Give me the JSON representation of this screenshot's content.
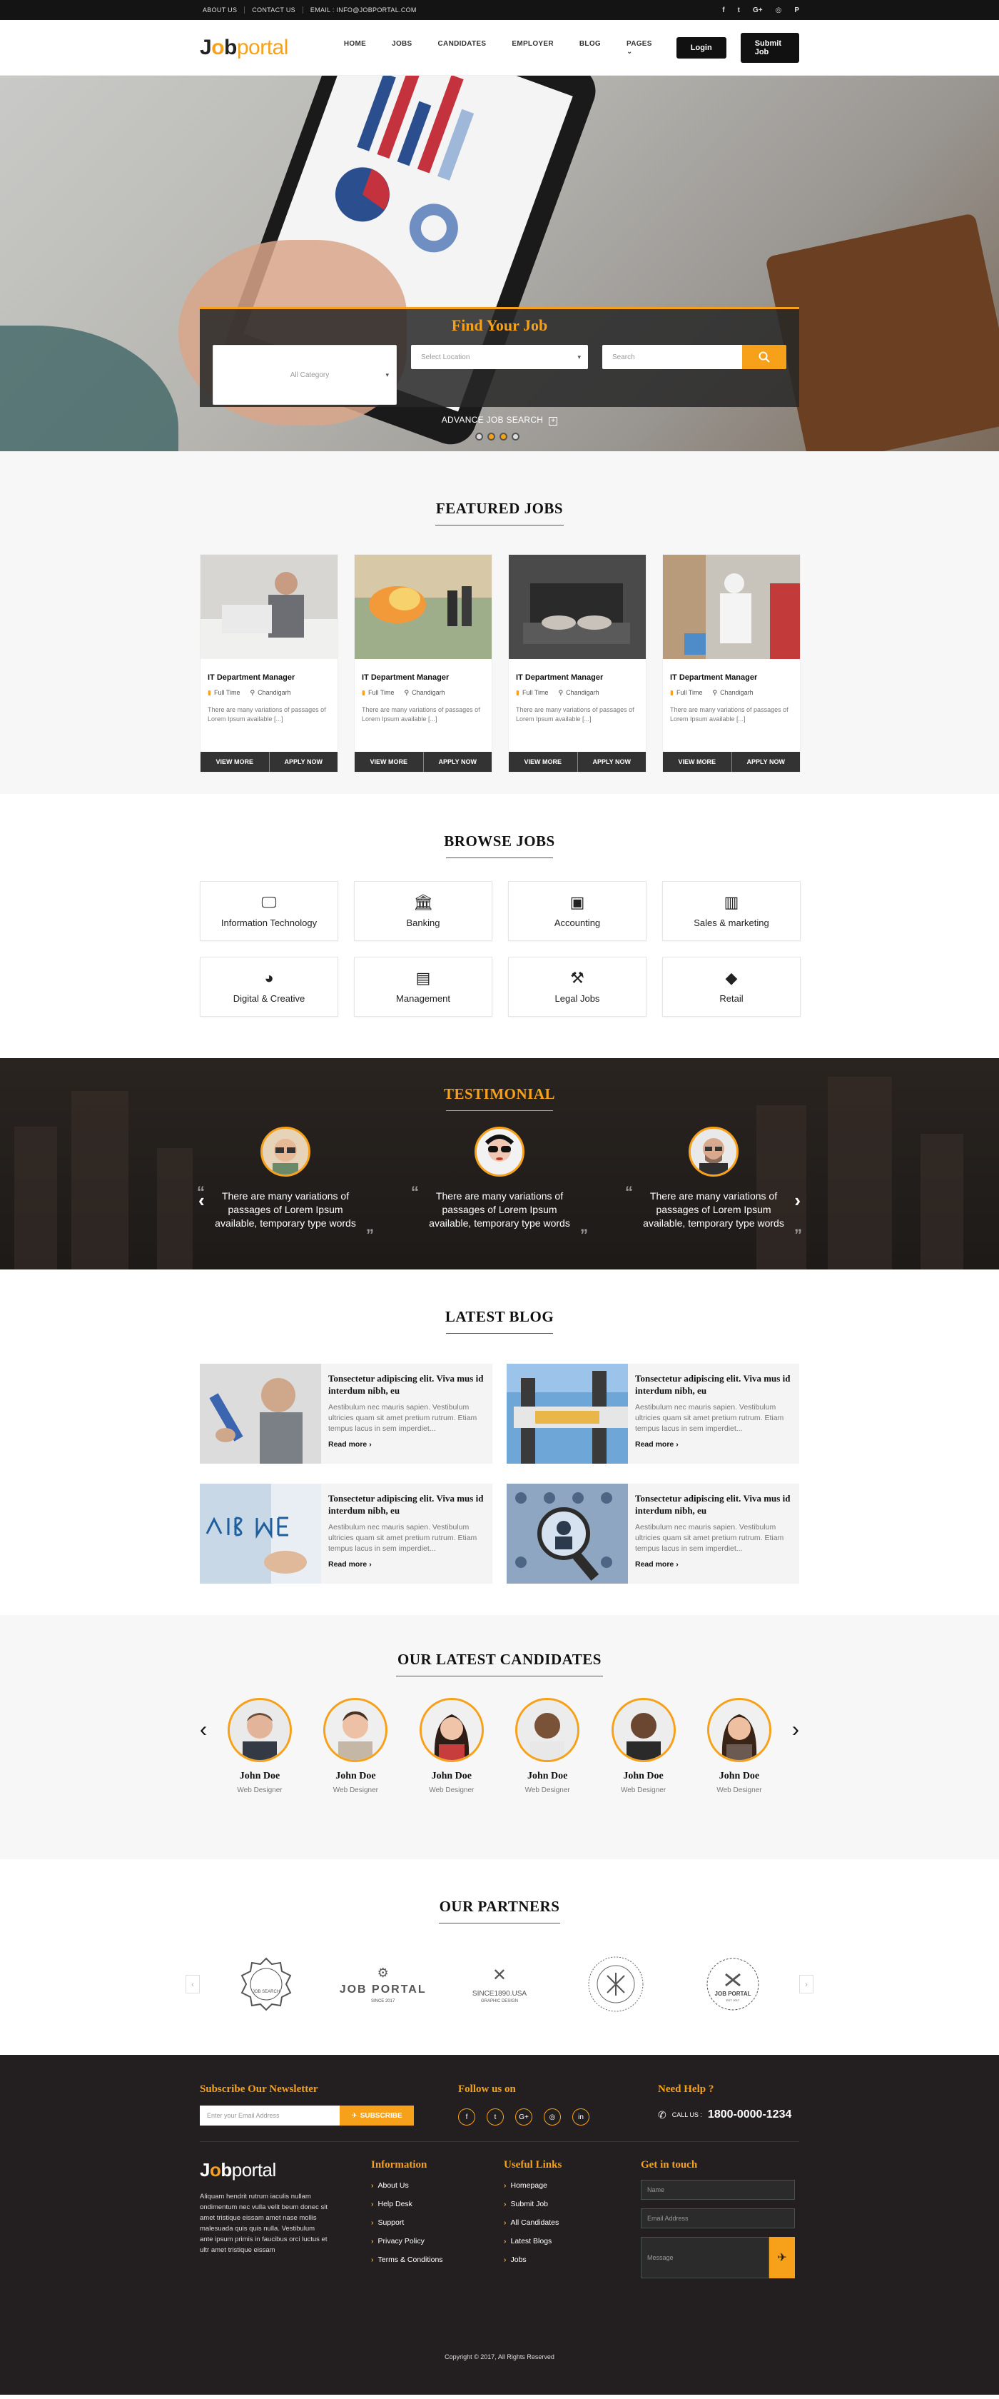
{
  "topbar": {
    "links": [
      "ABOUT US",
      "CONTACT US",
      "EMAIL : INFO@JOBPORTAL.COM"
    ],
    "socials": [
      "f",
      "t",
      "G+",
      "◎",
      "P"
    ]
  },
  "header": {
    "logo_j": "J",
    "logo_o": "o",
    "logo_b": "b",
    "logo_portal": "portal",
    "nav": [
      "HOME",
      "JOBS",
      "CANDIDATES",
      "EMPLOYER",
      "BLOG",
      "PAGES"
    ],
    "login": "Login",
    "submit": "Submit Job"
  },
  "hero": {
    "title": "Find Your Job",
    "category_placeholder": "All Category",
    "location_placeholder": "Select Location",
    "search_placeholder": "Search",
    "advance": "ADVANCE JOB SEARCH",
    "slide_index": 2,
    "slide_count": 4
  },
  "featured": {
    "title": "FEATURED JOBS",
    "jobs": [
      {
        "title": "IT Department Manager",
        "type": "Full Time",
        "location": "Chandigarh",
        "desc": "There are many variations of passages of Lorem Ipsum available [...]",
        "view": "VIEW MORE",
        "apply": "APPLY NOW"
      },
      {
        "title": "IT Department Manager",
        "type": "Full Time",
        "location": "Chandigarh",
        "desc": "There are many variations of passages of Lorem Ipsum available [...]",
        "view": "VIEW MORE",
        "apply": "APPLY NOW"
      },
      {
        "title": "IT Department Manager",
        "type": "Full Time",
        "location": "Chandigarh",
        "desc": "There are many variations of passages of Lorem Ipsum available [...]",
        "view": "VIEW MORE",
        "apply": "APPLY NOW"
      },
      {
        "title": "IT Department Manager",
        "type": "Full Time",
        "location": "Chandigarh",
        "desc": "There are many variations of passages of Lorem Ipsum available [...]",
        "view": "VIEW MORE",
        "apply": "APPLY NOW"
      }
    ]
  },
  "browse": {
    "title": "BROWSE JOBS",
    "categories": [
      {
        "label": "Information Technology",
        "icon": "monitor-icon"
      },
      {
        "label": "Banking",
        "icon": "bank-icon"
      },
      {
        "label": "Accounting",
        "icon": "money-icon"
      },
      {
        "label": "Sales & marketing",
        "icon": "bar-chart-icon"
      },
      {
        "label": "Digital & Creative",
        "icon": "palette-icon"
      },
      {
        "label": "Management",
        "icon": "briefcase-icon"
      },
      {
        "label": "Legal Jobs",
        "icon": "gavel-icon"
      },
      {
        "label": "Retail",
        "icon": "tags-icon"
      }
    ]
  },
  "testimonial": {
    "title": "TESTIMONIAL",
    "items": [
      {
        "quote": "There are many variations of passages of Lorem Ipsum available, temporary type words"
      },
      {
        "quote": "There are many variations of passages of Lorem Ipsum available, temporary type words"
      },
      {
        "quote": "There are many variations of passages of Lorem Ipsum available, temporary type words"
      }
    ]
  },
  "blog": {
    "title": "LATEST BLOG",
    "posts": [
      {
        "title": "Tonsectetur adipiscing elit. Viva mus id interdum nibh, eu",
        "excerpt": "Aestibulum nec mauris sapien. Vestibulum ultricies quam sit amet pretium rutrum. Etiam tempus lacus in sem imperdiet...",
        "more": "Read more"
      },
      {
        "title": "Tonsectetur adipiscing elit. Viva mus id interdum nibh, eu",
        "excerpt": "Aestibulum nec mauris sapien. Vestibulum ultricies quam sit amet pretium rutrum. Etiam tempus lacus in sem imperdiet...",
        "more": "Read more"
      },
      {
        "title": "Tonsectetur adipiscing elit. Viva mus id interdum nibh, eu",
        "excerpt": "Aestibulum nec mauris sapien. Vestibulum ultricies quam sit amet pretium rutrum. Etiam tempus lacus in sem imperdiet...",
        "more": "Read more"
      },
      {
        "title": "Tonsectetur adipiscing elit. Viva mus id interdum nibh, eu",
        "excerpt": "Aestibulum nec mauris sapien. Vestibulum ultricies quam sit amet pretium rutrum. Etiam tempus lacus in sem imperdiet...",
        "more": "Read more"
      }
    ]
  },
  "candidates": {
    "title": "OUR LATEST CANDIDATES",
    "items": [
      {
        "name": "John Doe",
        "role": "Web Designer"
      },
      {
        "name": "John Doe",
        "role": "Web Designer"
      },
      {
        "name": "John Doe",
        "role": "Web Designer"
      },
      {
        "name": "John Doe",
        "role": "Web Designer"
      },
      {
        "name": "John Doe",
        "role": "Web Designer"
      },
      {
        "name": "John Doe",
        "role": "Web Designer"
      }
    ]
  },
  "partners": {
    "title": "OUR PARTNERS",
    "logos": [
      {
        "line1": "JOB SEARCH",
        "line2": ""
      },
      {
        "line1": "JOB PORTAL",
        "line2": "SINCE 2017"
      },
      {
        "line1": "SINCE1890.USA",
        "line2": "GRAPHIC DESIGN"
      },
      {
        "line1": "",
        "line2": ""
      },
      {
        "line1": "JOB PORTAL",
        "line2": "EST. 2017"
      }
    ]
  },
  "footer": {
    "newsletter_title": "Subscribe Our Newsletter",
    "email_placeholder": "Enter your Email Address",
    "subscribe": "SUBSCRIBE",
    "follow_title": "Follow us on",
    "follow_icons": [
      "f",
      "t",
      "G+",
      "◎",
      "in"
    ],
    "help_title": "Need Help ?",
    "call_label": "CALL US :",
    "phone": "1800-0000-1234",
    "about": "Aliquam hendrit rutrum iaculis nullam ondimentum nec vulla velit beum donec sit amet tristique eissam amet nase mollis malesuada quis quis nulla. Vestibulum ante ipsum primis in faucibus orci luctus et ultr amet tristique eissam",
    "info_title": "Information",
    "info_links": [
      "About Us",
      "Help Desk",
      "Support",
      "Privacy Policy",
      "Terms & Conditions"
    ],
    "useful_title": "Useful Links",
    "useful_links": [
      "Homepage",
      "Submit Job",
      "All Candidates",
      "Latest Blogs",
      "Jobs"
    ],
    "contact_title": "Get in touch",
    "name_placeholder": "Name",
    "email2_placeholder": "Email Address",
    "message_placeholder": "Message",
    "copyright": "Copyright © 2017, All Rights Reserved"
  },
  "colors": {
    "accent": "#f7a11a",
    "dark": "#141414",
    "footer": "#231f20"
  }
}
